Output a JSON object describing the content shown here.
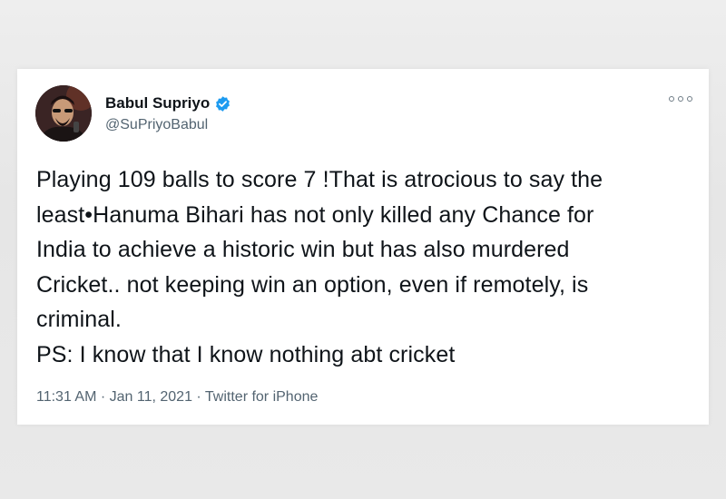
{
  "tweet": {
    "author": {
      "display_name": "Babul Supriyo",
      "handle": "@SuPriyoBabul",
      "verified": true,
      "verified_color": "#1d9bf0"
    },
    "text_lines": [
      "Playing 109 balls to score 7 !That is atrocious to say the",
      "least•Hanuma Bihari has not only killed any Chance for",
      "India to achieve a historic win but has also murdered",
      "Cricket.. not keeping win an option, even if remotely, is",
      "criminal.",
      "PS: I know that I know nothing abt cricket"
    ],
    "meta": "11:31 AM · Jan 11, 2021 · Twitter for iPhone",
    "more_icon": "more-options-icon"
  }
}
